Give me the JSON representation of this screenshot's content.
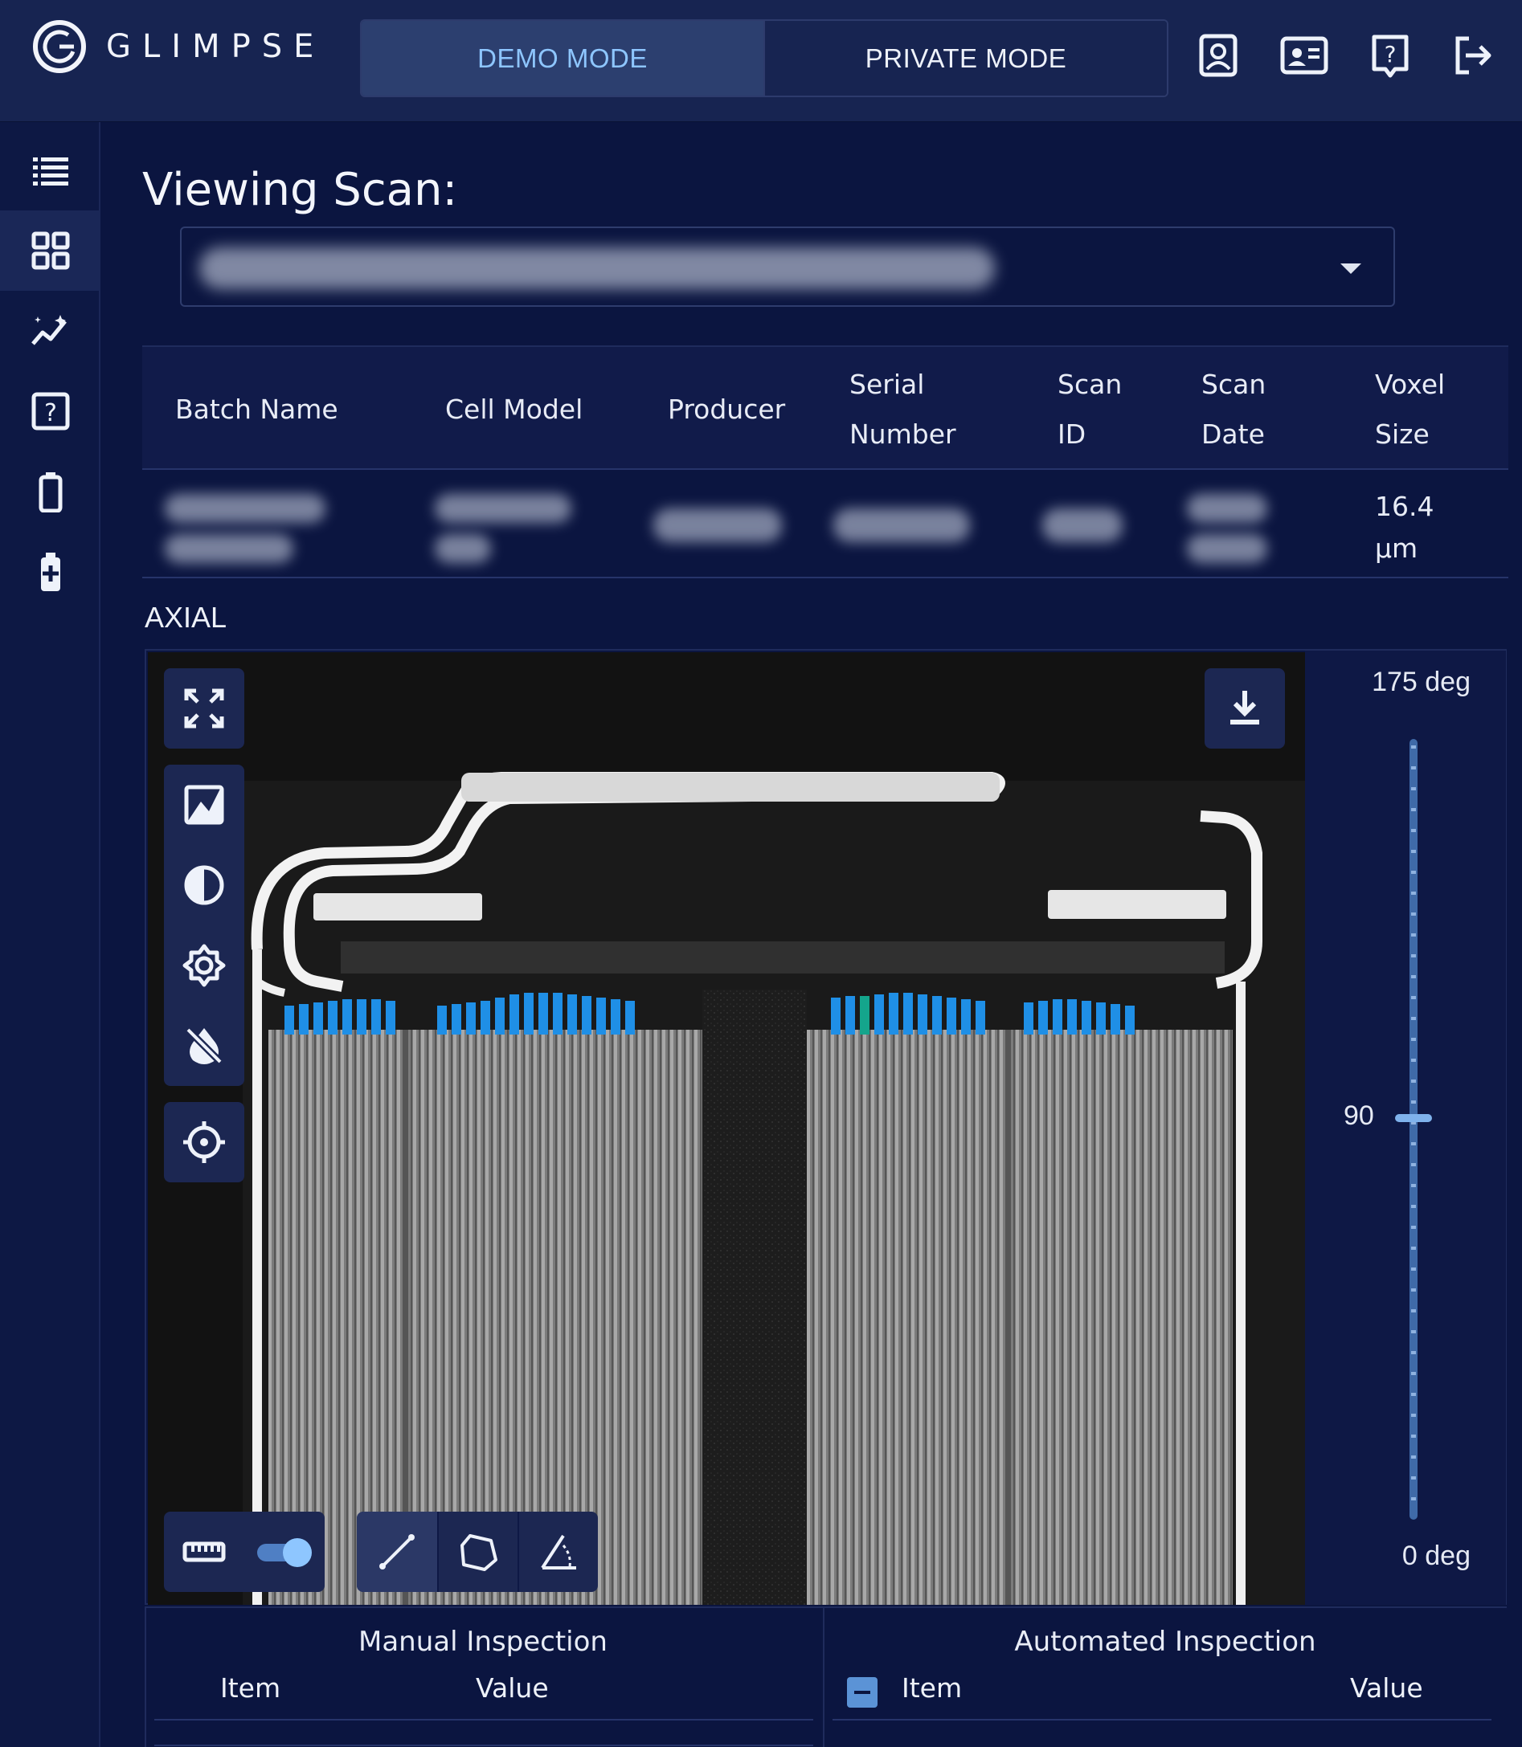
{
  "app": {
    "name": "GLIMPSE"
  },
  "header": {
    "modes": [
      {
        "label": "DEMO MODE",
        "active": true
      },
      {
        "label": "PRIVATE MODE",
        "active": false
      }
    ],
    "icons": [
      "account-icon",
      "id-card-icon",
      "help-icon",
      "logout-icon"
    ]
  },
  "sidebar": {
    "items": [
      {
        "icon": "list-icon",
        "active": false
      },
      {
        "icon": "grid-icon",
        "active": true
      },
      {
        "icon": "analytics-icon",
        "active": false
      },
      {
        "icon": "help-icon",
        "active": false
      },
      {
        "icon": "battery-icon",
        "active": false
      },
      {
        "icon": "battery-charge-icon",
        "active": false
      }
    ]
  },
  "scan": {
    "viewing_label": "Viewing Scan:",
    "selected_value": ""
  },
  "info_table": {
    "headers": [
      [
        "Batch Name"
      ],
      [
        "Cell Model"
      ],
      [
        "Producer"
      ],
      [
        "Serial",
        "Number"
      ],
      [
        "Scan",
        "ID"
      ],
      [
        "Scan",
        "Date"
      ],
      [
        "Voxel",
        "Size"
      ]
    ],
    "row": {
      "voxel_size_value": "16.4",
      "voxel_size_unit": "µm"
    }
  },
  "viewer": {
    "view_label": "AXIAL",
    "angle_max": "175 deg",
    "angle_min": "0 deg",
    "angle_current": "90",
    "angle_current_fraction": 0.514,
    "measure_toggle_on": true,
    "colors": {
      "highlight": "#1f8fe6",
      "highlight_alt": "#14a58c",
      "panel": "#1c2752",
      "background": "#0b1540"
    }
  },
  "manual_inspection": {
    "title": "Manual Inspection",
    "item_header": "Item",
    "value_header": "Value"
  },
  "automated_inspection": {
    "title": "Automated Inspection",
    "item_header": "Item",
    "value_header": "Value"
  }
}
